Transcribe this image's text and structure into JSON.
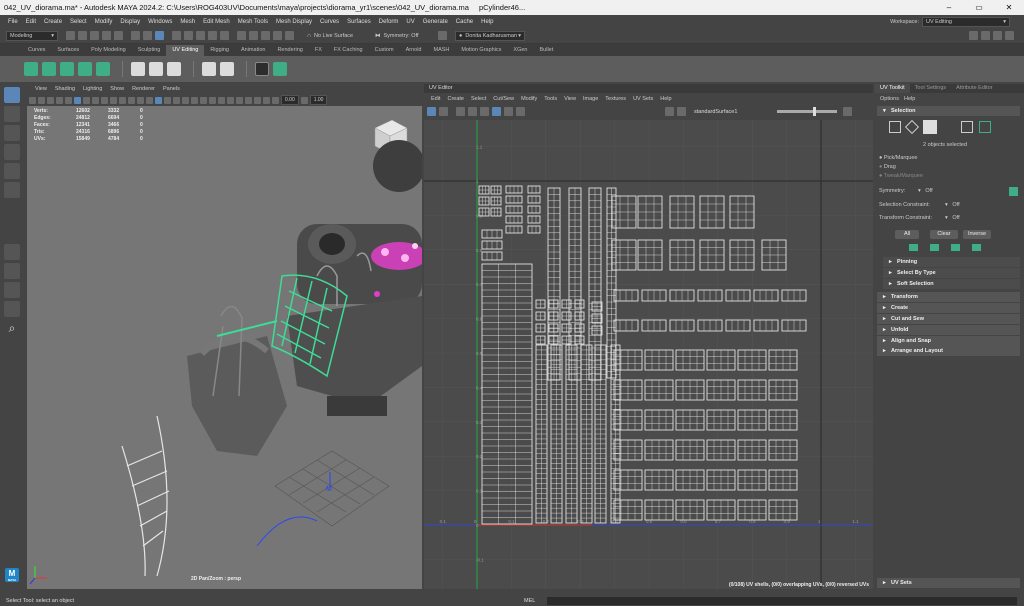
{
  "window": {
    "title": "042_UV_diorama.ma* - Autodesk MAYA 2024.2: C:\\Users\\ROG403UV\\Documents\\maya\\projects\\diorama_yr1\\scenes\\042_UV_diorama.ma",
    "object": "pCylinder46...",
    "controls": [
      "–",
      "▭",
      "✕"
    ]
  },
  "menubar": {
    "items": [
      "File",
      "Edit",
      "Create",
      "Select",
      "Modify",
      "Display",
      "Windows",
      "Mesh",
      "Edit Mesh",
      "Mesh Tools",
      "Mesh Display",
      "Curves",
      "Surfaces",
      "Deform",
      "UV",
      "Generate",
      "Cache",
      "Help"
    ],
    "workspace_label": "Workspace:",
    "workspace_value": "UV Editing"
  },
  "statusline": {
    "mode": "Modeling",
    "live_surface": "No Live Surface",
    "symmetry": "Symmetry: Off",
    "user": "Donita Kadharusman"
  },
  "shelf": {
    "tabs": [
      "Curves",
      "Surfaces",
      "Poly Modeling",
      "Sculpting",
      "UV Editing",
      "Rigging",
      "Animation",
      "Rendering",
      "FX",
      "FX Caching",
      "Custom",
      "Arnold",
      "MASH",
      "Motion Graphics",
      "XGen",
      "Bullet"
    ],
    "active_tab": "UV Editing"
  },
  "viewport": {
    "menu": [
      "View",
      "Shading",
      "Lighting",
      "Show",
      "Renderer",
      "Panels"
    ],
    "field_a": "0.00",
    "field_b": "1.00",
    "hud": [
      {
        "label": "Verts:",
        "a": "12602",
        "b": "3332",
        "c": "0"
      },
      {
        "label": "Edges:",
        "a": "24812",
        "b": "6694",
        "c": "0"
      },
      {
        "label": "Faces:",
        "a": "12341",
        "b": "3466",
        "c": "0"
      },
      {
        "label": "Tris:",
        "a": "24316",
        "b": "6896",
        "c": "0"
      },
      {
        "label": "UVs:",
        "a": "15849",
        "b": "4784",
        "c": "0"
      }
    ],
    "camera_label": "2D Pan/Zoom : persp",
    "cube_label": "BACK"
  },
  "uv_editor": {
    "panel_title": "UV Editor",
    "menu": [
      "Edit",
      "Create",
      "Select",
      "Cut/Sew",
      "Modify",
      "Tools",
      "View",
      "Image",
      "Textures",
      "UV Sets",
      "Help"
    ],
    "uv_set": "standardSurface1",
    "x_ticks": [
      "0.1",
      "0",
      "0.1",
      "0.2",
      "0.3",
      "0.4",
      "0.5",
      "0.6",
      "0.7",
      "0.8",
      "0.9",
      "1",
      "1.1"
    ],
    "y_ticks": [
      "1.1",
      "1",
      "0.9",
      "0.8",
      "0.7",
      "0.6",
      "0.5",
      "0.4",
      "0.3",
      "0.2",
      "0.1",
      "0",
      "-0.1"
    ],
    "status": "(0/108) UV shells, (0/0) overlapping UVs, (0/0) reversed UVs"
  },
  "uv_toolkit": {
    "tabs": [
      "UV Toolkit",
      "Tool Settings",
      "Attribute Editor"
    ],
    "menu": [
      "Options",
      "Help"
    ],
    "selection_header": "Selection",
    "objects_selected": "2 objects selected",
    "pick_options": [
      "Pick/Marquee",
      "Drag",
      "Tweak/Marquee"
    ],
    "symmetry_label": "Symmetry:",
    "symmetry_value": "Off",
    "selection_constraint_label": "Selection Constraint:",
    "selection_constraint_value": "Off",
    "transform_constraint_label": "Transform Constraint:",
    "transform_constraint_value": "Off",
    "buttons": [
      "All",
      "Clear",
      "Inverse"
    ],
    "sub_sections": [
      "Pinning",
      "Select By Type",
      "Soft Selection"
    ],
    "sections": [
      "Transform",
      "Create",
      "Cut and Sew",
      "Unfold",
      "Align and Snap",
      "Arrange and Layout"
    ],
    "footer_section": "UV Sets"
  },
  "helpline": "Select Tool: select an object",
  "commandline": {
    "mode": "MEL"
  },
  "logo": {
    "letter": "M",
    "sub": "MAYA"
  },
  "colors": {
    "accent": "#5a86b8",
    "uv_wire": "#ffffff",
    "selected_wire": "#3ddc97",
    "spheres": "#e040c8"
  }
}
